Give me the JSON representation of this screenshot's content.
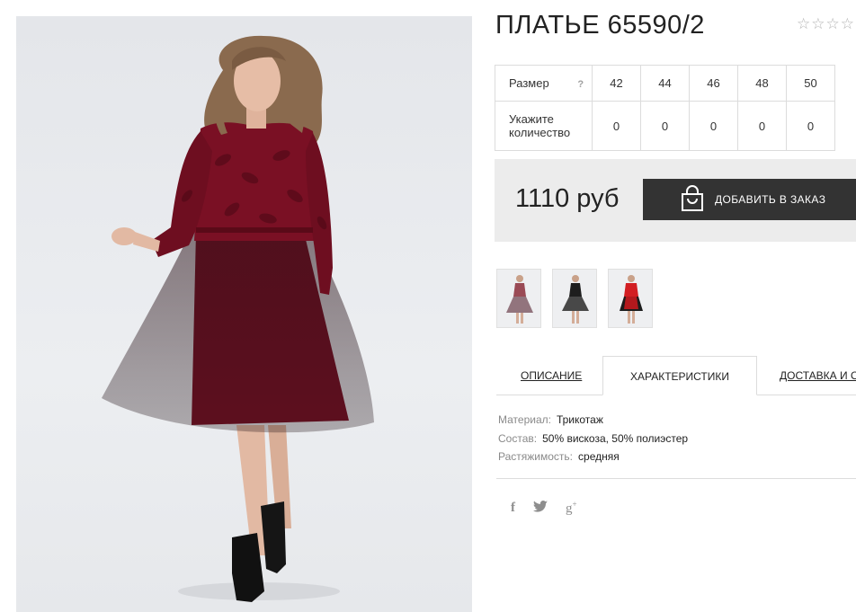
{
  "product": {
    "title": "ПЛАТЬЕ 65590/2",
    "rating": {
      "stars": 5,
      "filled": 0
    }
  },
  "sizes": {
    "size_label": "Размер",
    "help_icon": "?",
    "qty_label": "Укажите количество",
    "values": [
      "42",
      "44",
      "46",
      "48",
      "50"
    ],
    "quantities": [
      "0",
      "0",
      "0",
      "0",
      "0"
    ]
  },
  "purchase": {
    "price": "1110 руб",
    "add_button_label": "ДОБАВИТЬ В ЗАКАЗ",
    "button_icon": "shopping-bag-icon"
  },
  "colors": {
    "button_bg": "#333333",
    "price_box_bg": "#ececec",
    "dress_burgundy": "#7a1024",
    "thumb_red": "#d21e22"
  },
  "tabs": [
    {
      "label": "ОПИСАНИЕ",
      "active": false
    },
    {
      "label": "ХАРАКТЕРИСТИКИ",
      "active": true
    },
    {
      "label": "ДОСТАВКА И ОПЛАТА",
      "active": false
    }
  ],
  "characteristics": [
    {
      "key": "Материал:",
      "value": "Трикотаж"
    },
    {
      "key": "Состав:",
      "value": "50% вискоза, 50% полиэстер"
    },
    {
      "key": "Растяжимость:",
      "value": "средняя"
    }
  ],
  "social": [
    {
      "icon": "facebook-icon",
      "glyph": "f"
    },
    {
      "icon": "twitter-icon",
      "glyph": "t"
    },
    {
      "icon": "google-plus-icon",
      "glyph": "g+"
    }
  ]
}
